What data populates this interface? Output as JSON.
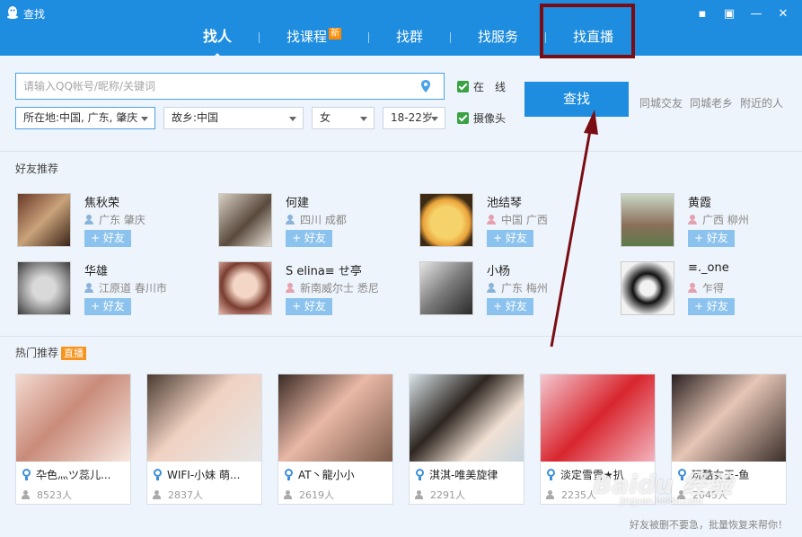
{
  "window": {
    "title": "查找"
  },
  "tabs": [
    {
      "label": "找人",
      "active": true
    },
    {
      "label": "找课程",
      "badge": "新"
    },
    {
      "label": "找群"
    },
    {
      "label": "找服务"
    },
    {
      "label": "找直播"
    }
  ],
  "search": {
    "placeholder": "请输入QQ帐号/昵称/关键词",
    "location_select": "所在地:中国, 广东, 肇庆",
    "hometown_select": "故乡:中国",
    "gender_select": "女",
    "age_select": "18-22岁",
    "online_label": "在　线",
    "camera_label": "摄像头",
    "find_button": "查找",
    "quick_links": [
      "同城交友",
      "同城老乡",
      "附近的人"
    ]
  },
  "friend_section": {
    "title": "好友推荐",
    "add_label": "+ 好友",
    "friends": [
      {
        "name": "焦秋荣",
        "location": "广东  肇庆",
        "gender": "male"
      },
      {
        "name": "何建",
        "location": "四川  成都",
        "gender": "male"
      },
      {
        "name": "池结琴",
        "location": "中国  广西",
        "gender": "female"
      },
      {
        "name": "黄霞",
        "location": "广西  柳州",
        "gender": "female"
      },
      {
        "name": "华雄",
        "location": "江原道  春川市",
        "gender": "male"
      },
      {
        "name": "S elina≡ せ亭",
        "location": "新南威尔士  悉尼",
        "gender": "female"
      },
      {
        "name": "小杨",
        "location": "广东  梅州",
        "gender": "male"
      },
      {
        "name": "≡._one",
        "location": "乍得",
        "gender": "female"
      }
    ]
  },
  "hot_section": {
    "title": "热门推荐",
    "badge": "直播",
    "cards": [
      {
        "title": "卆色灬ツ蕊儿...",
        "views": "8523人"
      },
      {
        "title": "WIFI-小妹 萌...",
        "views": "2837人"
      },
      {
        "title": "AT丶龍小小",
        "views": "2619人"
      },
      {
        "title": "淇淇-唯美旋律",
        "views": "2291人"
      },
      {
        "title": "淡定雪雪★扒",
        "views": "2235人"
      },
      {
        "title": "玩酷女王-鱼",
        "views": "2045人"
      }
    ]
  },
  "watermark": {
    "text": "Baidu 经验",
    "sub": "jingyan.baidu.com"
  },
  "footer_note": "好友被删不要急，批量恢复来帮你！"
}
